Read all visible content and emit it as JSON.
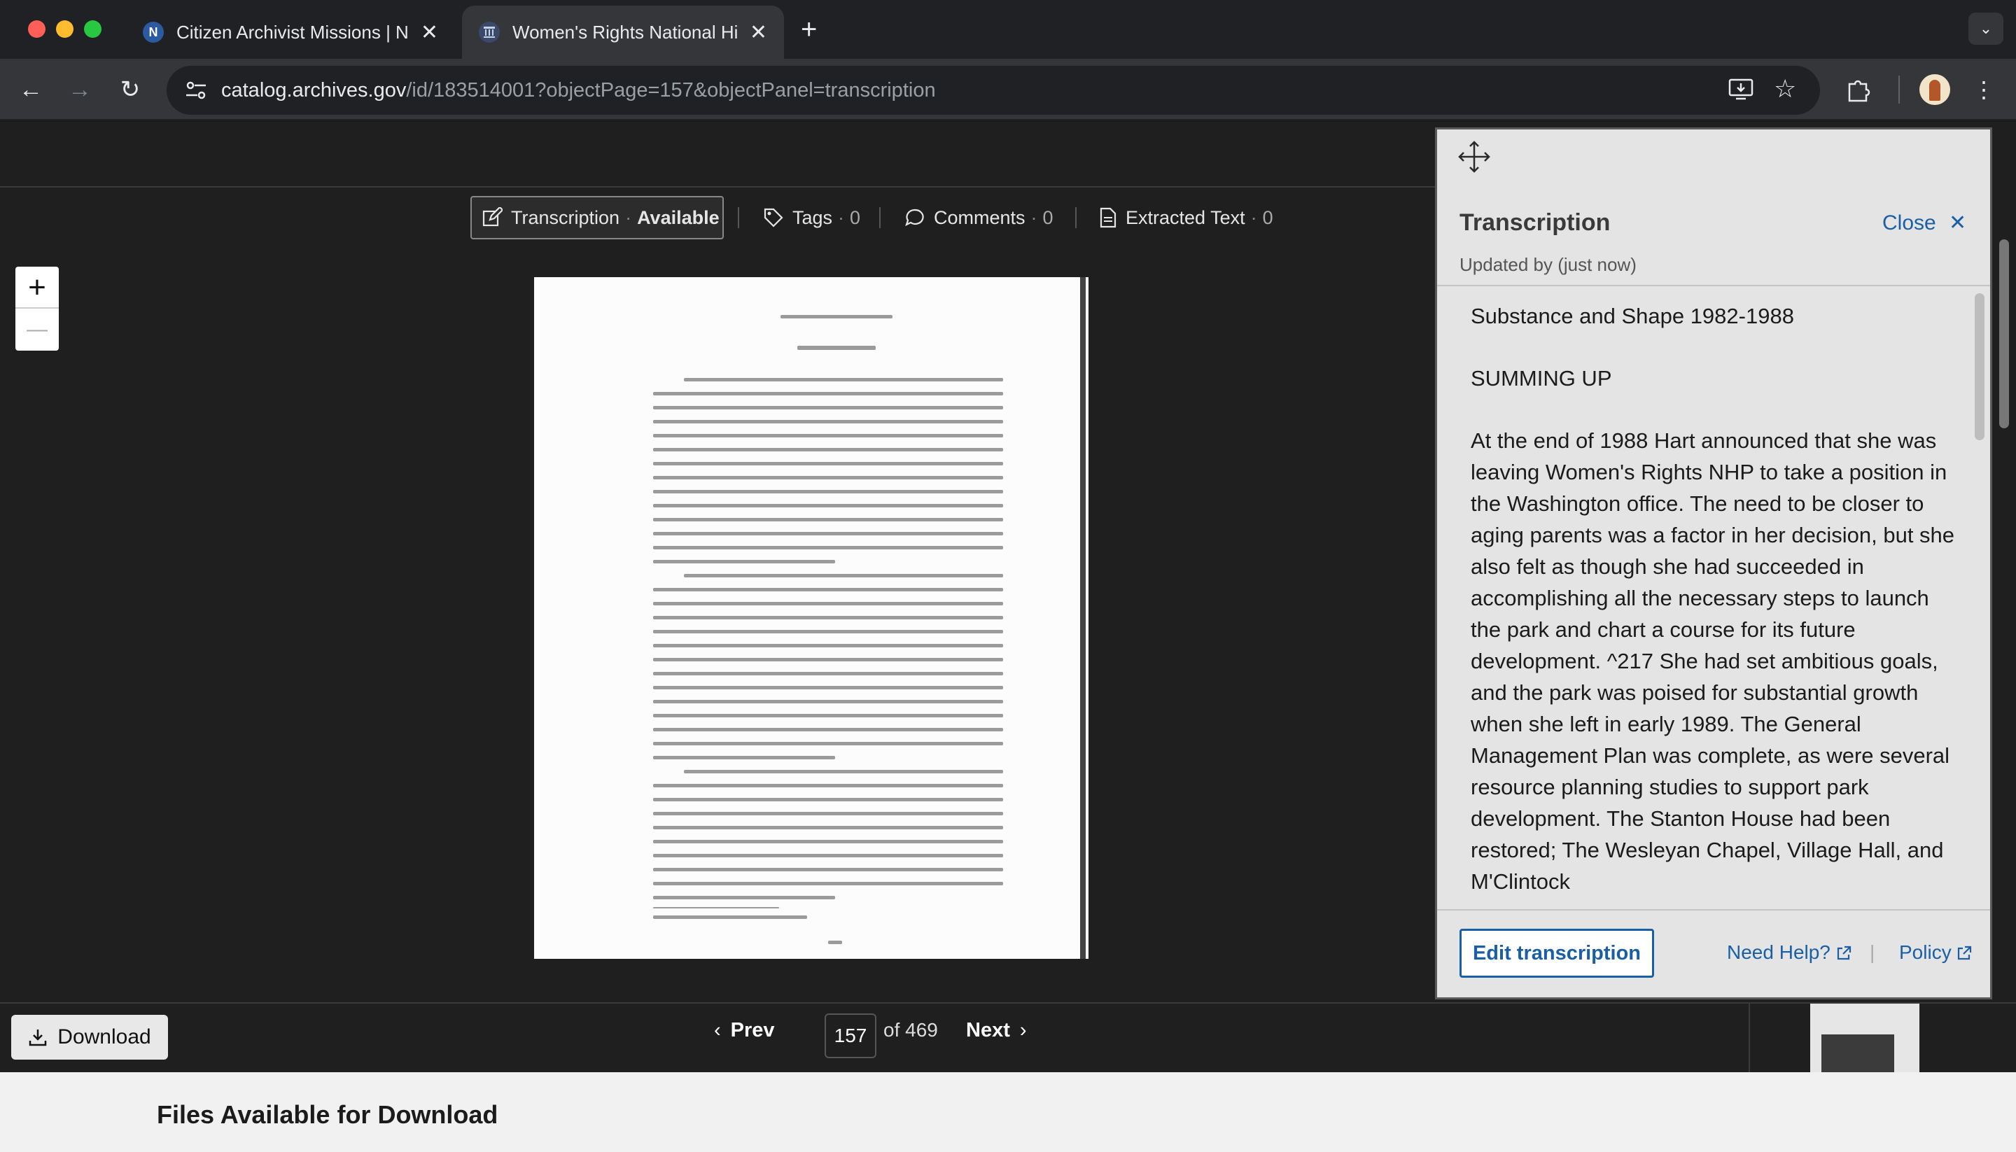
{
  "browser": {
    "tabs": [
      {
        "icon": "N",
        "title": "Citizen Archivist Missions | Na",
        "active": false
      },
      {
        "icon": "archives-icon",
        "title": "Women's Rights National Hist",
        "active": true
      }
    ],
    "new_tab": "+",
    "url_host": "catalog.archives.gov",
    "url_path": "/id/183514001?objectPage=157&objectPanel=transcription"
  },
  "viewer": {
    "panel_tabs": [
      {
        "label": "Transcription",
        "sep": "·",
        "status": "Available"
      },
      {
        "label": "Tags",
        "sep": "·",
        "count": "0"
      },
      {
        "label": "Comments",
        "sep": "·",
        "count": "0"
      },
      {
        "label": "Extracted Text",
        "sep": "·",
        "count": "0"
      }
    ],
    "zoom_in": "+",
    "zoom_out": "—",
    "download_label": "Download",
    "prev_label": "Prev",
    "next_label": "Next",
    "current_page": "157",
    "of_pages": "of 469"
  },
  "files_title": "Files Available for Download",
  "transcription": {
    "title": "Transcription",
    "close_label": "Close",
    "updated": "Updated by (just now)",
    "paragraphs": [
      "Substance and Shape 1982-1988",
      "SUMMING UP",
      "At the end of 1988 Hart announced that she was leaving Women's Rights NHP to take a position in the Washington office. The need to be closer to aging parents was a factor in her decision, but she also felt as though she had succeeded in accomplishing all the necessary steps to launch the park and chart a course for its future development. ^217 She had set ambitious goals, and the park was poised for substantial growth when she left in early 1989. The General Management Plan was complete, as were several resource planning studies to support park development. The Stanton House had been restored; The Wesleyan Chapel, Village Hall, and M'Clintock"
    ],
    "edit_label": "Edit transcription",
    "help_label": "Need Help?",
    "separator": "|",
    "policy_label": "Policy"
  }
}
